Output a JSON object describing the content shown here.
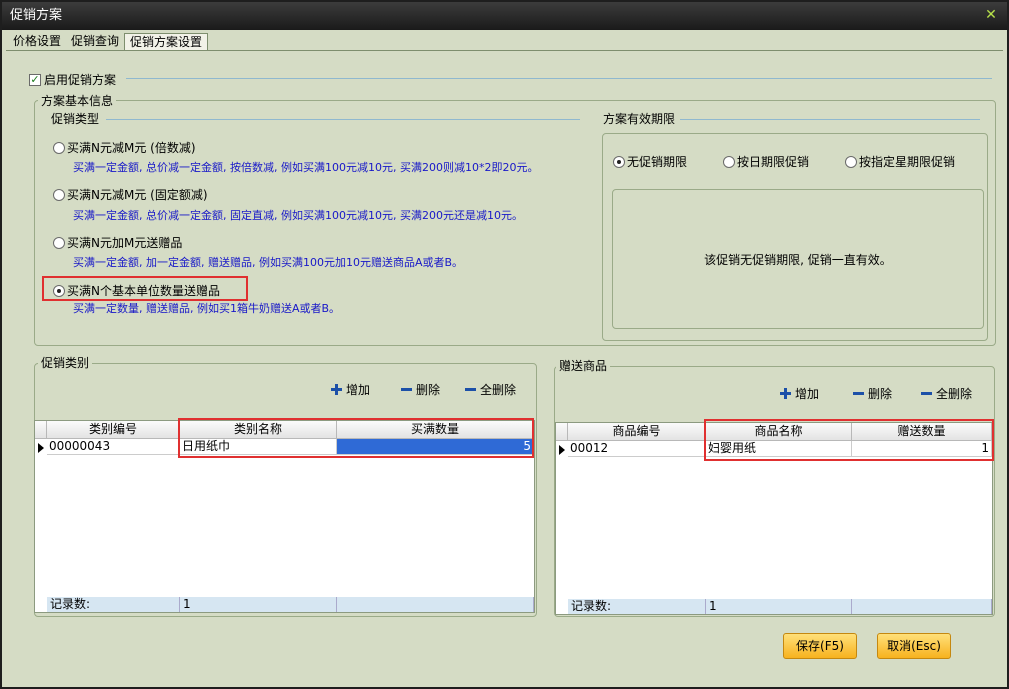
{
  "window": {
    "title": "促销方案"
  },
  "tabs": [
    {
      "label": "价格设置"
    },
    {
      "label": "促销查询"
    },
    {
      "label": "促销方案设置"
    }
  ],
  "enable_checkbox": {
    "label": "启用促销方案",
    "checked": true
  },
  "basic_info": {
    "title": "方案基本信息"
  },
  "promo_type": {
    "title": "促销类型",
    "options": [
      {
        "label": "买满N元减M元 (倍数减)",
        "desc": "买满一定金额, 总价减一定金额, 按倍数减, 例如买满100元减10元, 买满200则减10*2即20元。",
        "selected": false
      },
      {
        "label": "买满N元减M元 (固定额减)",
        "desc": "买满一定金额, 总价减一定金额, 固定直减, 例如买满100元减10元, 买满200元还是减10元。",
        "selected": false
      },
      {
        "label": "买满N元加M元送赠品",
        "desc": "买满一定金额, 加一定金额, 赠送赠品, 例如买满100元加10元赠送商品A或者B。",
        "selected": false
      },
      {
        "label": "买满N个基本单位数量送赠品",
        "desc": "买满一定数量, 赠送赠品, 例如买1箱牛奶赠送A或者B。",
        "selected": true
      }
    ]
  },
  "validity": {
    "title": "方案有效期限",
    "options": [
      {
        "label": "无促销期限",
        "selected": true
      },
      {
        "label": "按日期限促销",
        "selected": false
      },
      {
        "label": "按指定星期限促销",
        "selected": false
      }
    ],
    "message": "该促销无促销期限, 促销一直有效。"
  },
  "category_panel": {
    "title": "促销类别",
    "toolbar": {
      "add": "增加",
      "delete": "删除",
      "delete_all": "全删除"
    },
    "columns": [
      "类别编号",
      "类别名称",
      "买满数量"
    ],
    "rows": [
      [
        "00000043",
        "日用纸巾",
        "5"
      ]
    ],
    "footer": {
      "label": "记录数:",
      "count": "1"
    }
  },
  "gift_panel": {
    "title": "赠送商品",
    "toolbar": {
      "add": "增加",
      "delete": "删除",
      "delete_all": "全删除"
    },
    "columns": [
      "商品编号",
      "商品名称",
      "赠送数量"
    ],
    "rows": [
      [
        "00012",
        "妇婴用纸",
        "1"
      ]
    ],
    "footer": {
      "label": "记录数:",
      "count": "1"
    }
  },
  "buttons": {
    "save": "保存(F5)",
    "cancel": "取消(Esc)"
  },
  "colors": {
    "accent_blue": "#1818c8",
    "highlight_red": "#e03030",
    "button_orange": "#f7b21f",
    "panel_bg": "#d5dcc5"
  }
}
